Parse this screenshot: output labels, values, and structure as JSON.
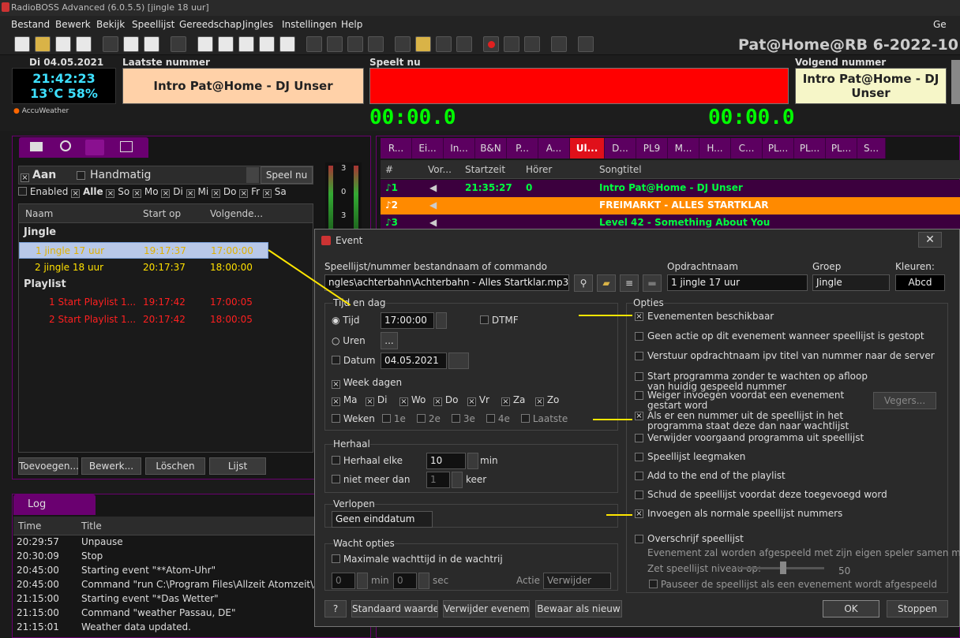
{
  "app": {
    "title": "RadioBOSS Advanced (6.0.5.5) [jingle 18 uur]",
    "station": "Pat@Home@RB 6-2022-10"
  },
  "menu": [
    "Bestand",
    "Bewerk",
    "Bekijk",
    "Speellijst",
    "Gereedschap",
    "Jingles",
    "Instellingen",
    "Help"
  ],
  "menu_right": "Ge",
  "info": {
    "date": "Di 04.05.2021",
    "time": "21:42:23",
    "weather": "13°C 58%",
    "weather_src": "AccuWeather"
  },
  "last": {
    "label": "Laatste nummer",
    "title": "Intro Pat@Home - DJ Unser"
  },
  "now": {
    "label": "Speelt nu",
    "t1": "00:00.0",
    "t2": "00:00.0"
  },
  "next": {
    "label": "Volgend nummer",
    "title": "Intro Pat@Home - DJ Unser"
  },
  "meter": {
    "top": "3",
    "mid": "0",
    "bot": "3"
  },
  "sched": {
    "aan": "Aan",
    "handmatig": "Handmatig",
    "speel_nu": "Speel nu",
    "enabled": "Enabled",
    "days": [
      "Alle",
      "So",
      "Mo",
      "Di",
      "Mi",
      "Do",
      "Fr",
      "Sa"
    ],
    "cols": [
      "Naam",
      "Start op",
      "Volgende..."
    ],
    "groups": [
      {
        "name": "Jingle",
        "rows": [
          {
            "name": "1 jingle 17 uur",
            "start": "19:17:37",
            "next": "17:00:00"
          },
          {
            "name": "2 jingle 18 uur",
            "start": "20:17:37",
            "next": "18:00:00"
          }
        ]
      },
      {
        "name": "Playlist",
        "rows": [
          {
            "name": "1 Start Playlist 1...",
            "start": "19:17:42",
            "next": "17:00:05"
          },
          {
            "name": "2 Start Playlist 1...",
            "start": "20:17:42",
            "next": "18:00:05"
          }
        ]
      }
    ],
    "buttons": [
      "Toevoegen...",
      "Bewerk...",
      "Löschen",
      "Lijst"
    ]
  },
  "log": {
    "tab": "Log",
    "cols": [
      "Time",
      "Title"
    ],
    "rows": [
      {
        "t": "20:29:57",
        "m": "Unpause"
      },
      {
        "t": "20:30:09",
        "m": "Stop"
      },
      {
        "t": "20:45:00",
        "m": "Starting event \"**Atom-Uhr\""
      },
      {
        "t": "20:45:00",
        "m": "Command \"run C:\\Program Files\\Allzeit Atomzeit\\A"
      },
      {
        "t": "21:15:00",
        "m": "Starting event \"*Das Wetter\""
      },
      {
        "t": "21:15:00",
        "m": "Command \"weather Passau, DE\""
      },
      {
        "t": "21:15:01",
        "m": "Weather data updated."
      }
    ]
  },
  "playlist": {
    "tabs": [
      "R...",
      "Ei...",
      "In...",
      "B&N",
      "P...",
      "A...",
      "Ul...",
      "D...",
      "PL9",
      "M...",
      "H...",
      "C...",
      "PL...",
      "PL...",
      "PL...",
      "S..."
    ],
    "cols": [
      "#",
      "Vor...",
      "Startzeit",
      "Hörer",
      "Songtitel"
    ],
    "rows": [
      {
        "n": "1",
        "start": "21:35:27",
        "h": "0",
        "title": "Intro Pat@Home - DJ Unser"
      },
      {
        "n": "2",
        "start": "",
        "h": "",
        "title": "FREIMARKT - ALLES STARTKLAR"
      },
      {
        "n": "3",
        "start": "",
        "h": "",
        "title": "Level 42 - Something About You"
      }
    ]
  },
  "dialog": {
    "title": "Event",
    "f_label": "Speellijst/nummer bestandnaam of commando",
    "f_value": "ngles\\achterbahn\\Achterbahn - Alles Startklar.mp3",
    "name_label": "Opdrachtnaam",
    "name_value": "1 jingle 17 uur",
    "grp_label": "Groep",
    "grp_value": "Jingle",
    "col_label": "Kleuren:",
    "col_value": "Abcd",
    "tijd_dag": "Tijd en dag",
    "tijd": "Tijd",
    "tijd_val": "17:00:00",
    "dtmf": "DTMF",
    "uren": "Uren",
    "uren_btn": "...",
    "datum": "Datum",
    "datum_val": "04.05.2021",
    "week_dagen": "Week dagen",
    "wd": [
      "Ma",
      "Di",
      "Wo",
      "Do",
      "Vr",
      "Za",
      "Zo"
    ],
    "weken": "Weken",
    "wk": [
      "1e",
      "2e",
      "3e",
      "4e",
      "Laatste"
    ],
    "herhaal": "Herhaal",
    "herhaal_elke": "Herhaal elke",
    "herhaal_val": "10",
    "min": "min",
    "niet_meer": "niet meer dan",
    "niet_val": "1",
    "keer": "keer",
    "verlopen": "Verlopen",
    "verlopen_val": "Geen einddatum",
    "wacht": "Wacht opties",
    "max_wacht": "Maximale wachttijd in de wachtrij",
    "w_min": "0",
    "w_min_lbl": "min",
    "w_sec": "0",
    "w_sec_lbl": "sec",
    "actie": "Actie",
    "actie_val": "Verwijder",
    "opties": "Opties",
    "opts": [
      {
        "l": "Evenementen beschikbaar",
        "c": true
      },
      {
        "l": "Geen actie op dit evenement wanneer speellijst is gestopt",
        "c": false
      },
      {
        "l": "Verstuur opdrachtnaam ipv titel van nummer naar de server",
        "c": false
      },
      {
        "l": "Start programma zonder te wachten op afloop van huidig gespeeld nummer",
        "c": false
      },
      {
        "l": "Weiger invoegen voordat een evenement gestart word",
        "c": false
      },
      {
        "l": "Als er een nummer uit de speellijst in het programma staat deze dan naar wachtlijst",
        "c": true
      },
      {
        "l": "Verwijder voorgaand programma uit speellijst",
        "c": false
      },
      {
        "l": "Speellijst leegmaken",
        "c": false
      },
      {
        "l": "Add to the end of the playlist",
        "c": false
      },
      {
        "l": "Schud de speellijst voordat deze toegevoegd word",
        "c": false
      },
      {
        "l": "Invoegen als normale speellijst nummers",
        "c": true
      },
      {
        "l": "Overschrijf speellijst",
        "c": false
      }
    ],
    "vegers": "Vegers...",
    "own_player": "Evenement zal worden afgespeeld met zijn eigen speler samen m",
    "niveau": "Zet speellijst niveau op:",
    "niveau_val": "50",
    "pauseer": "Pauseer de speellijst als een evenement wordt afgespeeld",
    "btn_help": "?",
    "btn_std": "Standaard waarden",
    "btn_del": "Verwijder evenement",
    "btn_new": "Bewaar als nieuw",
    "btn_ok": "OK",
    "btn_cancel": "Stoppen"
  },
  "colors": {
    "accent": "#6a0070",
    "now_bar": "#ff0000",
    "last_bg": "#ffd1a8",
    "next_bg": "#f6f6c8",
    "active_tab": "#e0101a",
    "highlight": "#ff8a00",
    "arrow": "#ffe600"
  }
}
